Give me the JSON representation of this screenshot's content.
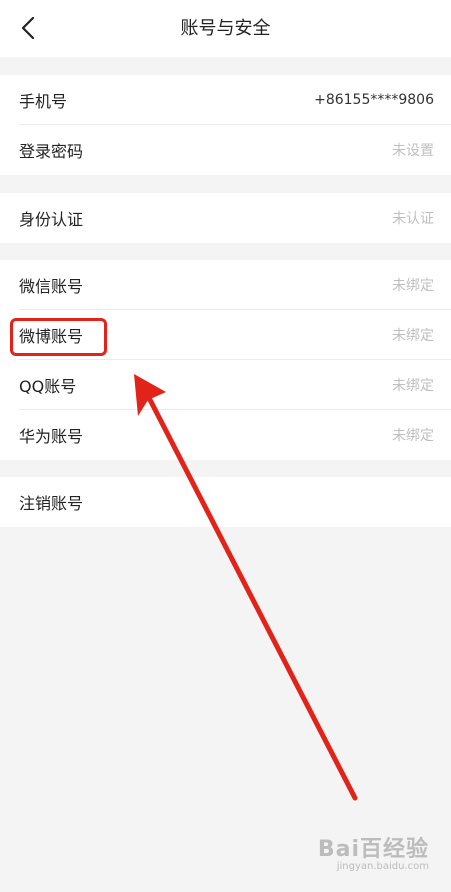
{
  "header": {
    "title": "账号与安全"
  },
  "sections": [
    {
      "items": [
        {
          "label": "手机号",
          "value": "+86155****9806"
        },
        {
          "label": "登录密码",
          "value": "未设置"
        }
      ]
    },
    {
      "items": [
        {
          "label": "身份认证",
          "value": "未认证"
        }
      ]
    },
    {
      "items": [
        {
          "label": "微信账号",
          "value": "未绑定"
        },
        {
          "label": "微博账号",
          "value": "未绑定"
        },
        {
          "label": "QQ账号",
          "value": "未绑定"
        },
        {
          "label": "华为账号",
          "value": "未绑定"
        }
      ]
    },
    {
      "items": [
        {
          "label": "注销账号",
          "value": ""
        }
      ]
    }
  ],
  "annotation": {
    "highlight_color": "#e2231a",
    "arrow_color": "#e2231a"
  },
  "watermark": {
    "text": "Bai百经验",
    "sub": "jingyan.baidu.com"
  },
  "colors": {
    "background": "#f4f4f4",
    "card": "#ffffff",
    "muted_text": "#bfbfbf"
  }
}
